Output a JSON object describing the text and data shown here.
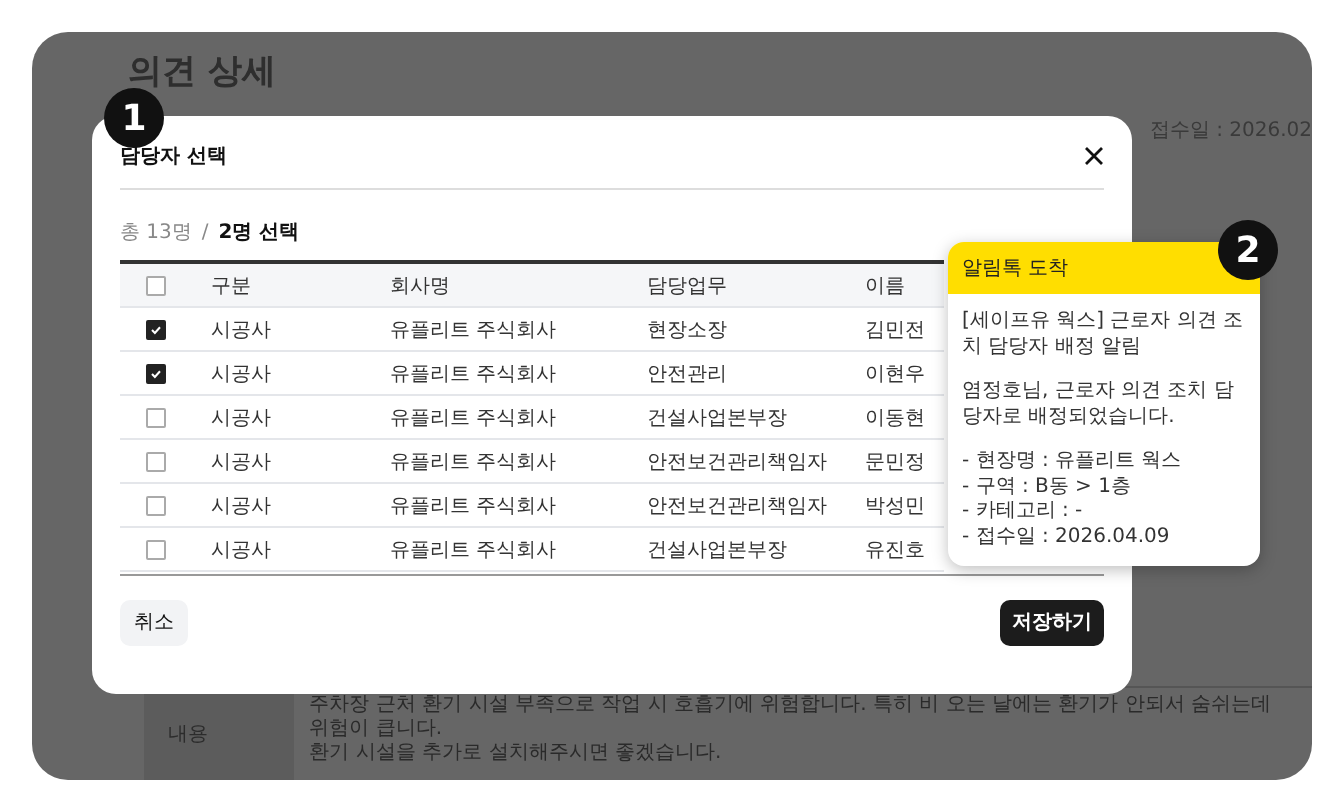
{
  "page": {
    "title": "의견 상세",
    "date_label": "접수일 : 2026.02",
    "content_label": "내용",
    "content_lines": [
      "주차장 근처 환기 시설 부족으로 작업 시 호흡기에 위험합니다. 특히 비 오는 날에는 환기가 안되서 숨쉬는데 위험이 큽니다.",
      "환기 시설을 추가로 설치해주시면 좋겠습니다."
    ]
  },
  "modal": {
    "title": "담당자 선택",
    "total": "총 13명",
    "separator": "/",
    "selected_count": "2명 선택",
    "columns": [
      "구분",
      "회사명",
      "담당업무",
      "이름"
    ],
    "header_checked": false,
    "rows": [
      {
        "checked": true,
        "cells": [
          "시공사",
          "유플리트 주식회사",
          "현장소장",
          "김민전"
        ]
      },
      {
        "checked": true,
        "cells": [
          "시공사",
          "유플리트 주식회사",
          "안전관리",
          "이현우"
        ]
      },
      {
        "checked": false,
        "cells": [
          "시공사",
          "유플리트 주식회사",
          "건설사업본부장",
          "이동현"
        ]
      },
      {
        "checked": false,
        "cells": [
          "시공사",
          "유플리트 주식회사",
          "안전보건관리책임자",
          "문민정"
        ]
      },
      {
        "checked": false,
        "cells": [
          "시공사",
          "유플리트 주식회사",
          "안전보건관리책임자",
          "박성민"
        ]
      },
      {
        "checked": false,
        "cells": [
          "시공사",
          "유플리트 주식회사",
          "건설사업본부장",
          "유진호"
        ]
      }
    ],
    "cancel": "취소",
    "save": "저장하기"
  },
  "toast": {
    "header": "알림톡 도착",
    "message": "[세이프유 웍스] 근로자 의견 조치 담당자 배정 알림",
    "greeting": "염정호님, 근로자 의견 조치 담당자로 배정되었습니다.",
    "details": [
      "- 현장명 : 유플리트 웍스",
      "- 구역 : B동 > 1층",
      "- 카테고리 : -",
      "- 접수일 : 2026.04.09"
    ]
  },
  "markers": [
    "1",
    "2"
  ]
}
